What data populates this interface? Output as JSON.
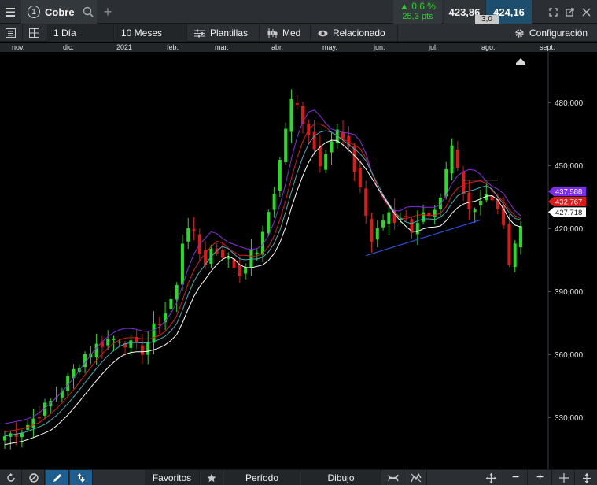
{
  "header": {
    "menu_icon": "hamburger-icon",
    "tab_number": "1",
    "symbol": "Cobre",
    "search_icon": "search-icon",
    "add_tab_label": "+",
    "change_pct": "▲ 0,6 %",
    "change_pts": "25,3 pts",
    "bid": "423,86",
    "ask": "424,16",
    "spread": "3,0",
    "window_icons": [
      "expand-icon",
      "popout-icon",
      "close-icon"
    ]
  },
  "toolbar": {
    "interval": "1 Día",
    "range": "10 Meses",
    "templates": "Plantillas",
    "price_type": "Med",
    "related": "Relacionado",
    "settings": "Configuración"
  },
  "time_axis": {
    "months": [
      "nov.",
      "dic.",
      "2021",
      "feb.",
      "mar.",
      "abr.",
      "may.",
      "jun.",
      "jul.",
      "ago.",
      "sept."
    ]
  },
  "price_axis": {
    "ticks": [
      "480,000",
      "450,000",
      "420,000",
      "390,000",
      "360,000",
      "330,000"
    ]
  },
  "price_labels": [
    {
      "value": "437,588",
      "color": "#7b2cf0"
    },
    {
      "value": "432,767",
      "color": "#e01818"
    },
    {
      "value": "427,718",
      "color": "#ffffff"
    }
  ],
  "colors": {
    "up_candle": "#20e020",
    "down_candle": "#e01818",
    "ma_purple": "#8a2be2",
    "ma_red": "#e01818",
    "ma_teal": "#3fb3c0",
    "ma_white": "#ffffff",
    "trendline": "#2a4fe0",
    "background": "#000000"
  },
  "bottombar": {
    "refresh_icon": "refresh-icon",
    "cancel_icon": "cancel-icon",
    "draw_icon": "pencil-icon",
    "arrow_icon": "up-down-arrow-icon",
    "favorites": "Favoritos",
    "star_icon": "star-icon",
    "period": "Período",
    "drawing": "Dibujo",
    "indicator_icon": "indicator-icon",
    "line_icon": "line-tool-icon",
    "crosshair_icon": "crosshair-icon",
    "zoom_out": "−",
    "zoom_in": "+",
    "cross_icon": "cross-icon",
    "fit_icon": "fit-icon"
  },
  "chart_data": {
    "type": "candlestick",
    "symbol": "Cobre",
    "interval": "1 Día",
    "range": "10 Meses",
    "x": [
      "nov.",
      "dic.",
      "2021",
      "feb.",
      "mar.",
      "abr.",
      "may.",
      "jun.",
      "jul.",
      "ago.",
      "sept."
    ],
    "ylim": [
      320,
      500
    ],
    "yticks": [
      480,
      450,
      420,
      390,
      360,
      330
    ],
    "close_path": [
      [
        0,
        321
      ],
      [
        3,
        324
      ],
      [
        6,
        332
      ],
      [
        9,
        340
      ],
      [
        12,
        352
      ],
      [
        14,
        360
      ],
      [
        16,
        364
      ],
      [
        18,
        367
      ],
      [
        20,
        368
      ],
      [
        22,
        364
      ],
      [
        24,
        362
      ],
      [
        25,
        366
      ],
      [
        26,
        372
      ],
      [
        28,
        380
      ],
      [
        30,
        392
      ],
      [
        31,
        414
      ],
      [
        32,
        422
      ],
      [
        33,
        416
      ],
      [
        34,
        408
      ],
      [
        35,
        404
      ],
      [
        36,
        410
      ],
      [
        38,
        408
      ],
      [
        40,
        402
      ],
      [
        41,
        398
      ],
      [
        42,
        404
      ],
      [
        44,
        410
      ],
      [
        45,
        416
      ],
      [
        46,
        428
      ],
      [
        47,
        438
      ],
      [
        48,
        452
      ],
      [
        49,
        468
      ],
      [
        50,
        480
      ],
      [
        51,
        478
      ],
      [
        52,
        472
      ],
      [
        53,
        466
      ],
      [
        54,
        458
      ],
      [
        55,
        452
      ],
      [
        56,
        458
      ],
      [
        57,
        462
      ],
      [
        58,
        466
      ],
      [
        59,
        462
      ],
      [
        60,
        456
      ],
      [
        61,
        448
      ],
      [
        62,
        440
      ],
      [
        63,
        426
      ],
      [
        64,
        414
      ],
      [
        65,
        418
      ],
      [
        66,
        424
      ],
      [
        67,
        428
      ],
      [
        68,
        424
      ],
      [
        69,
        426
      ],
      [
        70,
        424
      ],
      [
        71,
        420
      ],
      [
        72,
        424
      ],
      [
        73,
        426
      ],
      [
        74,
        424
      ],
      [
        75,
        426
      ],
      [
        76,
        432
      ],
      [
        77,
        446
      ],
      [
        78,
        458
      ],
      [
        79,
        448
      ],
      [
        80,
        436
      ],
      [
        81,
        432
      ],
      [
        82,
        430
      ],
      [
        83,
        434
      ],
      [
        84,
        438
      ],
      [
        85,
        434
      ],
      [
        86,
        428
      ],
      [
        87,
        420
      ],
      [
        88,
        404
      ],
      [
        89,
        410
      ],
      [
        90,
        424
      ]
    ],
    "moving_averages": [
      {
        "color": "purple",
        "last": 437.588
      },
      {
        "color": "red",
        "last": 432.767
      },
      {
        "color": "white",
        "last": 427.718
      }
    ],
    "trendline": [
      [
        63,
        407
      ],
      [
        83,
        424
      ]
    ],
    "resistance_line": [
      [
        80,
        443
      ],
      [
        86,
        443
      ]
    ]
  }
}
